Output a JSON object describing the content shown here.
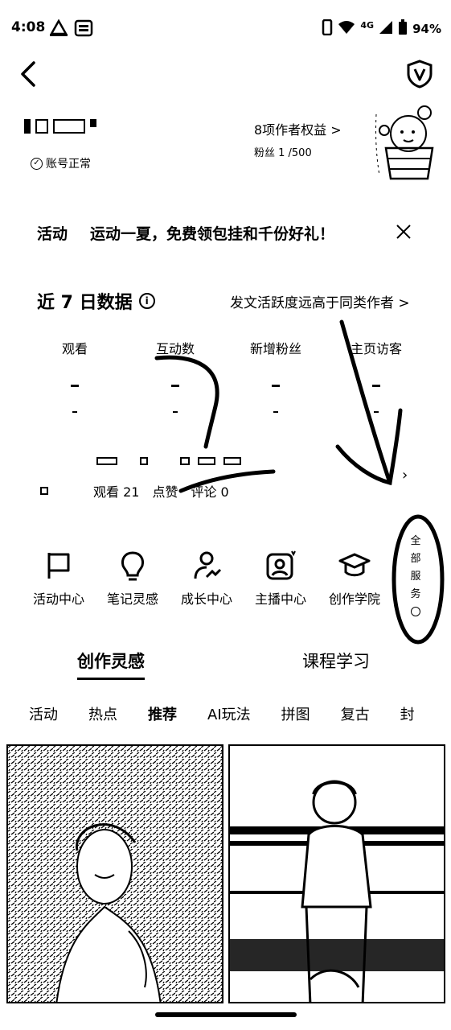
{
  "status_bar": {
    "time": "4:08",
    "network": "4G",
    "battery": "94%"
  },
  "account": {
    "status": "账号正常",
    "benefits": "8项作者权益 >",
    "fans_label": "粉丝 1 /500"
  },
  "activity": {
    "tag": "活动",
    "text": "运动一夏，免费领包挂和千份好礼！"
  },
  "data_section": {
    "title": "近 7 日数据",
    "compare": "发文活跃度远高于同类作者 >",
    "metrics": [
      "观看",
      "互动数",
      "新增粉丝",
      "主页访客"
    ],
    "note_stats": [
      "观看 21",
      "点赞",
      "评论 0"
    ]
  },
  "services": {
    "items": [
      "活动中心",
      "笔记灵感",
      "成长中心",
      "主播中心",
      "创作学院"
    ],
    "all_label": [
      "全",
      "部",
      "服",
      "务"
    ]
  },
  "main_tabs": [
    "创作灵感",
    "课程学习"
  ],
  "categories": [
    "活动",
    "热点",
    "推荐",
    "AI玩法",
    "拼图",
    "复古",
    "封"
  ],
  "active_category": "推荐"
}
